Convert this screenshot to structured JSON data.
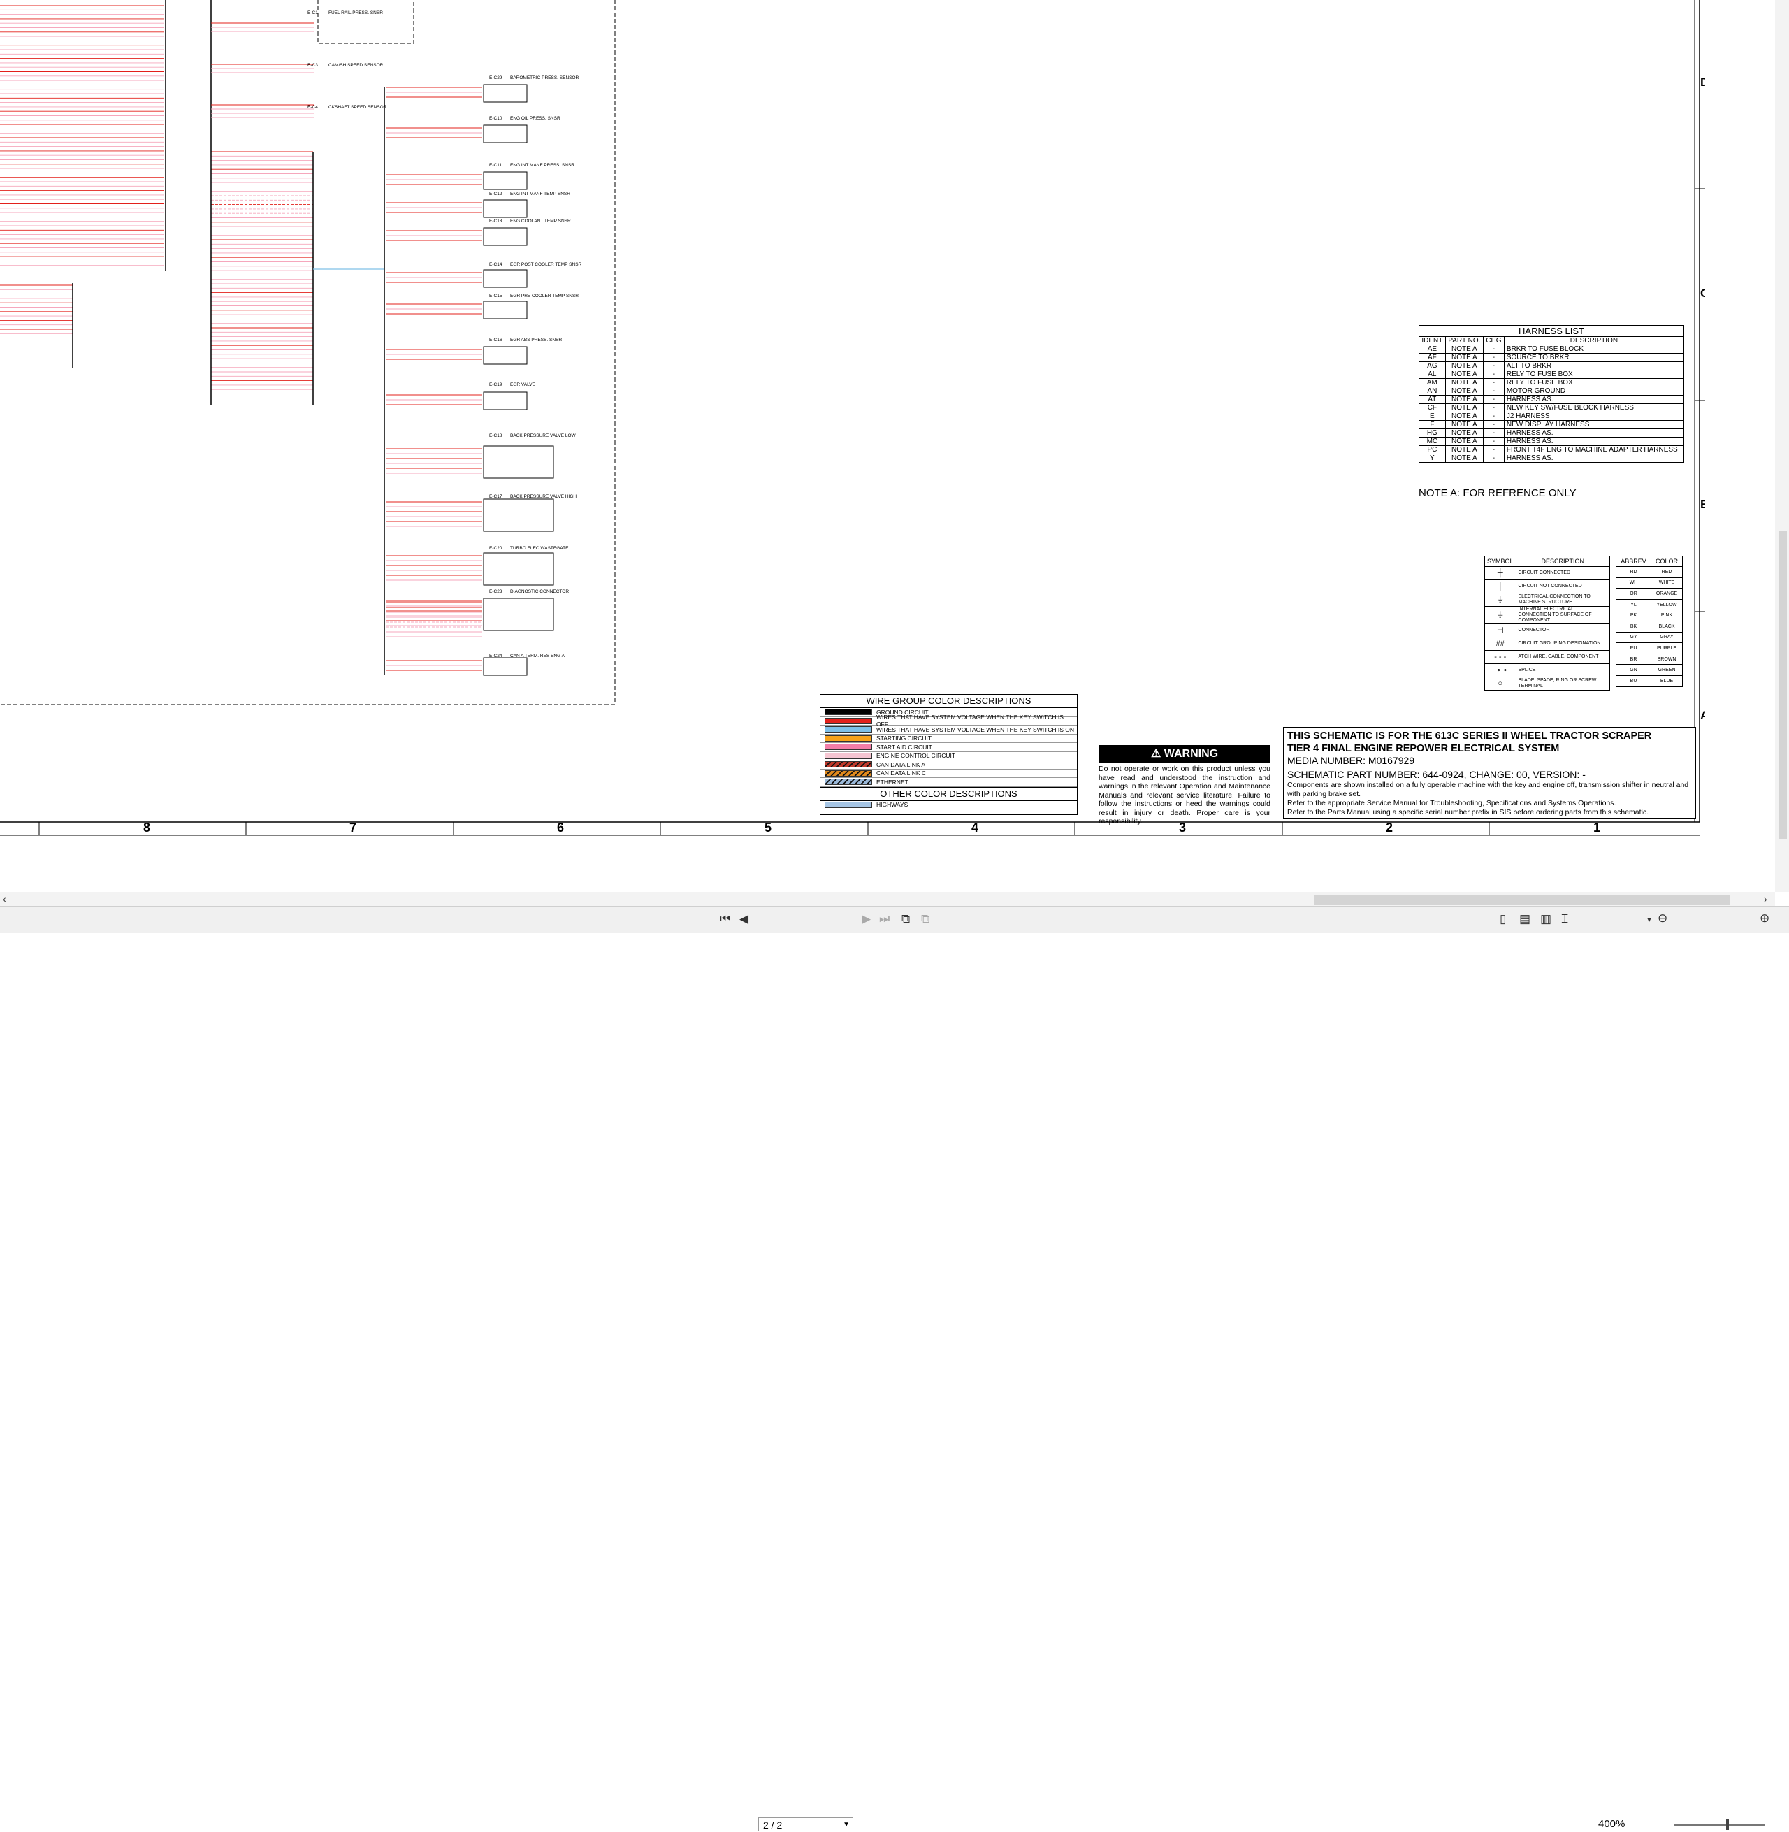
{
  "components": [
    {
      "ref": "E-C1",
      "name": "FUEL RAIL PRESS. SNSR"
    },
    {
      "ref": "E-C3",
      "name": "CAM/SH SPEED SENSOR"
    },
    {
      "ref": "E-C4",
      "name": "CKSHAFT SPEED SENSOR"
    },
    {
      "ref": "E-C29",
      "name": "BAROMETRIC PRESS. SENSOR"
    },
    {
      "ref": "E-C10",
      "name": "ENG OIL PRESS. SNSR"
    },
    {
      "ref": "E-C11",
      "name": "ENG INT MANF PRESS. SNSR"
    },
    {
      "ref": "E-C12",
      "name": "ENG INT MANF TEMP SNSR"
    },
    {
      "ref": "E-C13",
      "name": "ENG COOLANT TEMP SNSR"
    },
    {
      "ref": "E-C14",
      "name": "EGR POST COOLER TEMP SNSR"
    },
    {
      "ref": "E-C15",
      "name": "EGR PRE COOLER TEMP SNSR"
    },
    {
      "ref": "E-C16",
      "name": "EGR ABS PRESS. SNSR"
    },
    {
      "ref": "E-C19",
      "name": "EGR VALVE"
    },
    {
      "ref": "E-C18",
      "name": "BACK PRESSURE VALVE LOW"
    },
    {
      "ref": "E-C17",
      "name": "BACK PRESSURE VALVE HIGH"
    },
    {
      "ref": "E-C20",
      "name": "TURBO ELEC WASTEGATE"
    },
    {
      "ref": "E-C23",
      "name": "DIAGNOSTIC CONNECTOR"
    },
    {
      "ref": "E-C24",
      "name": "CAN A TERM. RES ENG A"
    }
  ],
  "harness_list": {
    "title": "HARNESS LIST",
    "headers": [
      "IDENT",
      "PART NO.",
      "CHG",
      "DESCRIPTION"
    ],
    "rows": [
      [
        "AE",
        "NOTE A",
        "-",
        "BRKR TO FUSE BLOCK"
      ],
      [
        "AF",
        "NOTE A",
        "-",
        "SOURCE TO BRKR"
      ],
      [
        "AG",
        "NOTE A",
        "-",
        "ALT TO BRKR"
      ],
      [
        "AL",
        "NOTE A",
        "-",
        "RELY TO FUSE BOX"
      ],
      [
        "AM",
        "NOTE A",
        "-",
        "RELY TO FUSE BOX"
      ],
      [
        "AN",
        "NOTE A",
        "-",
        "MOTOR GROUND"
      ],
      [
        "AT",
        "NOTE A",
        "-",
        "HARNESS AS."
      ],
      [
        "CF",
        "NOTE A",
        "-",
        "NEW KEY SW/FUSE BLOCK HARNESS"
      ],
      [
        "E",
        "NOTE A",
        "-",
        "J2 HARNESS"
      ],
      [
        "F",
        "NOTE A",
        "-",
        "NEW DISPLAY HARNESS"
      ],
      [
        "HG",
        "NOTE A",
        "-",
        "HARNESS AS."
      ],
      [
        "MC",
        "NOTE A",
        "-",
        "HARNESS AS."
      ],
      [
        "PC",
        "NOTE A",
        "-",
        "FRONT T4F ENG TO MACHINE ADAPTER HARNESS"
      ],
      [
        "Y",
        "NOTE A",
        "-",
        "HARNESS AS."
      ]
    ]
  },
  "note_a": "NOTE A: FOR REFRENCE ONLY",
  "symbols": {
    "headers": [
      "SYMBOL",
      "DESCRIPTION"
    ],
    "rows": [
      {
        "glyph": "┼",
        "desc": "CIRCUIT CONNECTED"
      },
      {
        "glyph": "┼",
        "desc": "CIRCUIT NOT CONNECTED"
      },
      {
        "glyph": "⏚",
        "desc": "ELECTRICAL CONNECTION TO MACHINE STRUCTURE"
      },
      {
        "glyph": "⏚",
        "desc": "INTERNAL ELECTRICAL CONNECTION TO SURFACE OF COMPONENT"
      },
      {
        "glyph": "⊣",
        "desc": "CONNECTOR"
      },
      {
        "glyph": "##",
        "desc": "CIRCUIT GROUPING DESIGNATION"
      },
      {
        "glyph": "- - -",
        "desc": "ATCH WIRE, CABLE, COMPONENT"
      },
      {
        "glyph": "⊸⊸",
        "desc": "SPLICE"
      },
      {
        "glyph": "○",
        "desc": "BLADE, SPADE, RING OR SCREW TERMINAL"
      }
    ]
  },
  "colors": {
    "headers": [
      "ABBREV",
      "COLOR"
    ],
    "rows": [
      [
        "RD",
        "RED"
      ],
      [
        "WH",
        "WHITE"
      ],
      [
        "OR",
        "ORANGE"
      ],
      [
        "YL",
        "YELLOW"
      ],
      [
        "PK",
        "PINK"
      ],
      [
        "BK",
        "BLACK"
      ],
      [
        "GY",
        "GRAY"
      ],
      [
        "PU",
        "PURPLE"
      ],
      [
        "BR",
        "BROWN"
      ],
      [
        "GN",
        "GREEN"
      ],
      [
        "BU",
        "BLUE"
      ]
    ]
  },
  "wire_group": {
    "title": "WIRE GROUP COLOR DESCRIPTIONS",
    "rows": [
      {
        "color": "#000000",
        "label": "GROUND CIRCUIT"
      },
      {
        "color": "#e3201b",
        "label": "WIRES THAT HAVE SYSTEM VOLTAGE WHEN THE KEY SWITCH IS OFF"
      },
      {
        "color": "#7fc0e8",
        "label": "WIRES THAT HAVE SYSTEM VOLTAGE WHEN THE KEY SWITCH IS ON"
      },
      {
        "color": "#f7a21b",
        "label": "STARTING CIRCUIT"
      },
      {
        "color": "#f27da8",
        "label": "START AID CIRCUIT"
      },
      {
        "color": "#f6c6d2",
        "label": "ENGINE CONTROL CIRCUIT"
      },
      {
        "color": "#c0392b",
        "label": "CAN DATA LINK A",
        "hatched": true
      },
      {
        "color": "#e08a1e",
        "label": "CAN DATA LINK C",
        "hatched": true
      },
      {
        "color": "#9ab8d8",
        "label": "ETHERNET",
        "hatched": true
      }
    ],
    "other_title": "OTHER COLOR DESCRIPTIONS",
    "other_rows": [
      {
        "color": "#a6c5e4",
        "label": "HIGHWAYS"
      }
    ]
  },
  "warning": {
    "title": "WARNING",
    "text": "Do not operate or work on this product unless you have read and understood the instruction and warnings in the relevant Operation and Maintenance Manuals and relevant service literature. Failure to follow the instructions or heed the warnings could result in injury or death. Proper care is your responsibility."
  },
  "title_block": {
    "line1": "THIS SCHEMATIC IS FOR THE 613C SERIES II WHEEL TRACTOR SCRAPER",
    "line2": "TIER 4 FINAL ENGINE REPOWER ELECTRICAL SYSTEM",
    "media": "MEDIA NUMBER: M0167929",
    "part": "SCHEMATIC PART NUMBER: 644-0924, CHANGE: 00, VERSION: -",
    "note1": "Components are shown installed on a fully operable machine with the key and engine off, transmission shifter in neutral and with parking brake set.",
    "note2": "Refer to the appropriate Service Manual for Troubleshooting, Specifications and Systems Operations.",
    "note3": "Refer to the Parts Manual using a specific serial number prefix in SIS before ordering parts from this schematic."
  },
  "grid": {
    "columns": [
      "8",
      "7",
      "6",
      "5",
      "4",
      "3",
      "2",
      "1"
    ],
    "rows": [
      "D",
      "C",
      "B",
      "A"
    ]
  },
  "viewer": {
    "page": "2 / 2",
    "zoom": "400%"
  }
}
